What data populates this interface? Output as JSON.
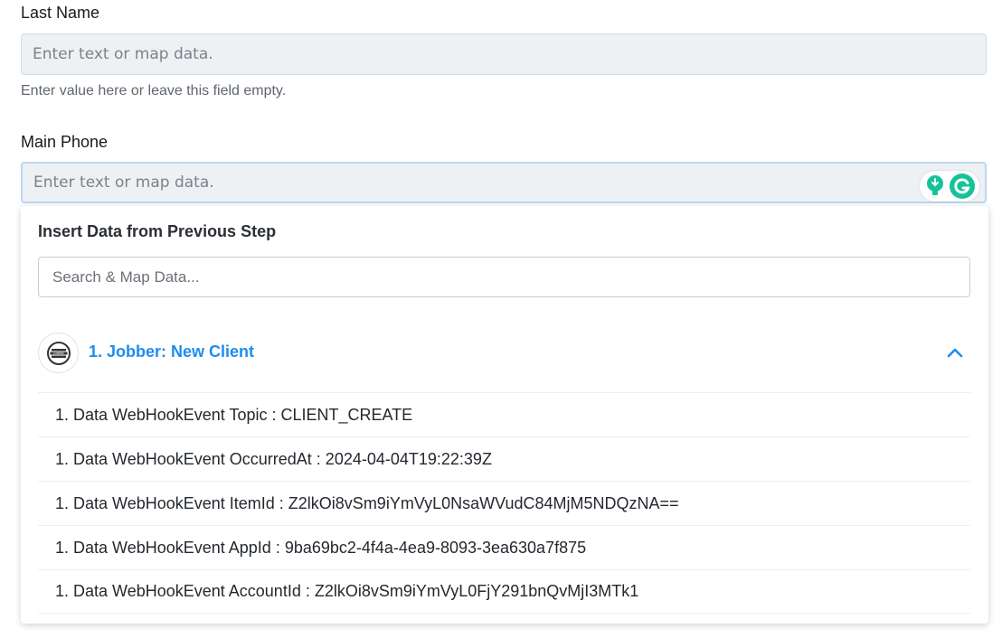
{
  "fields": {
    "last_name": {
      "label": "Last Name",
      "placeholder": "Enter text or map data.",
      "hint": "Enter value here or leave this field empty."
    },
    "main_phone": {
      "label": "Main Phone",
      "placeholder": "Enter text or map data."
    }
  },
  "dropdown": {
    "title": "Insert Data from Previous Step",
    "search_placeholder": "Search & Map Data...",
    "source": {
      "name": "1. Jobber: New Client",
      "logo_text": "JOBBER"
    },
    "items": [
      "1. Data WebHookEvent Topic : CLIENT_CREATE",
      "1. Data WebHookEvent OccurredAt : 2024-04-04T19:22:39Z",
      "1. Data WebHookEvent ItemId : Z2lkOi8vSm9iYmVyL0NsaWVudC84MjM5NDQzNA==",
      "1. Data WebHookEvent AppId : 9ba69bc2-4f4a-4ea9-8093-3ea630a7f875",
      "1. Data WebHookEvent AccountId : Z2lkOi8vSm9iYmVyL0FjY291bnQvMjI3MTk1"
    ]
  },
  "colors": {
    "accent": "#1d8cf0",
    "grammarly_green": "#15c39a"
  },
  "icons": [
    "lightbulb-icon",
    "grammarly-icon",
    "jobber-logo",
    "chevron-up-icon"
  ]
}
